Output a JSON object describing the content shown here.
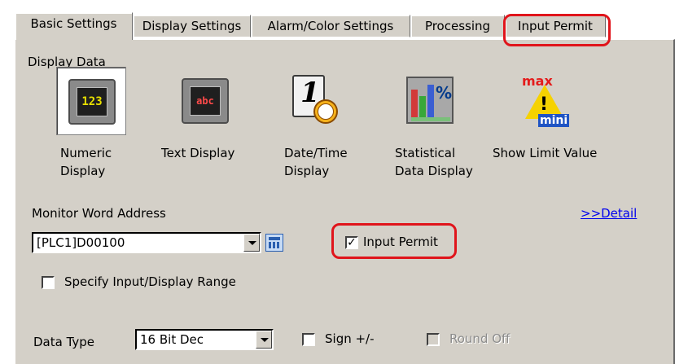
{
  "tabs": [
    {
      "label": "Basic Settings",
      "active": true
    },
    {
      "label": "Display Settings",
      "active": false
    },
    {
      "label": "Alarm/Color Settings",
      "active": false
    },
    {
      "label": "Processing",
      "active": false
    },
    {
      "label": "Input Permit",
      "active": false
    }
  ],
  "display_data": {
    "heading": "Display Data",
    "items": [
      {
        "icon": "numeric-display-icon",
        "glyph": "123",
        "line1": "Numeric",
        "line2": "Display",
        "selected": true
      },
      {
        "icon": "text-display-icon",
        "glyph": "abc",
        "line1": "Text Display",
        "line2": "",
        "selected": false
      },
      {
        "icon": "date-time-display-icon",
        "glyph": "1",
        "line1": "Date/Time",
        "line2": "Display",
        "selected": false
      },
      {
        "icon": "statistical-data-display-icon",
        "glyph": "%",
        "line1": "Statistical",
        "line2": "Data Display",
        "selected": false
      },
      {
        "icon": "show-limit-value-icon",
        "glyph_top": "max",
        "glyph_bottom": "mini",
        "line1": "Show Limit Value",
        "line2": "",
        "selected": false
      }
    ]
  },
  "monitor": {
    "label": "Monitor Word Address",
    "address_value": "[PLC1]D00100",
    "detail_link": ">>Detail",
    "input_permit_label": "Input Permit",
    "input_permit_checked": true
  },
  "range": {
    "label": "Specify Input/Display Range",
    "checked": false
  },
  "data_type": {
    "label": "Data Type",
    "value": "16 Bit Dec",
    "sign_label": "Sign +/-",
    "sign_checked": false,
    "round_off_label": "Round Off",
    "round_off_enabled": false
  },
  "colors": {
    "highlight": "#e0141b",
    "panel": "#d4d0c8",
    "link": "#0000ee"
  }
}
